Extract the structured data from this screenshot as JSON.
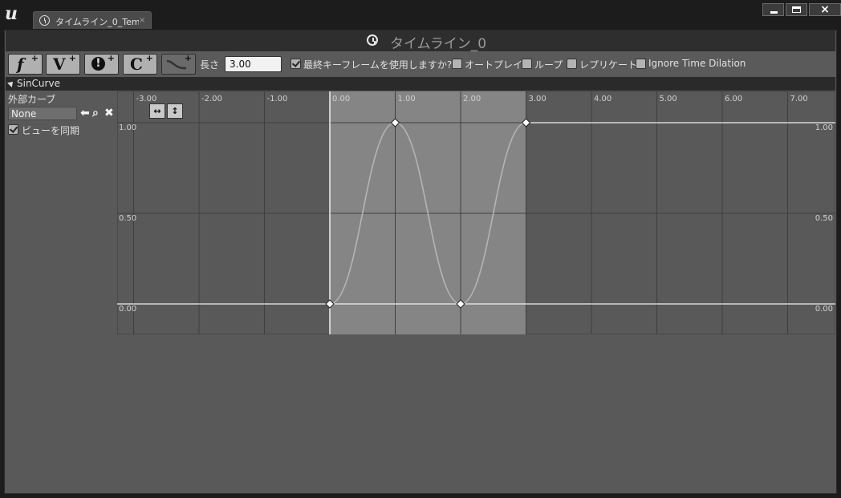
{
  "window": {
    "tab_title": "タイムライン_0_Tem",
    "tab_close": "×",
    "controls": {
      "minimize": "minimize",
      "maximize": "maximize",
      "close": "×"
    }
  },
  "header": {
    "title": "タイムライン_0"
  },
  "toolbar": {
    "buttons": [
      {
        "glyph": "f",
        "plus": "+"
      },
      {
        "glyph": "V",
        "plus": "+"
      },
      {
        "glyph": "!",
        "plus": "+"
      },
      {
        "glyph": "C",
        "plus": "+"
      },
      {
        "glyph": "~",
        "plus": "+"
      }
    ],
    "length_label": "長さ",
    "length_value": "3.00",
    "use_last_keyframe": {
      "label": "最終キーフレームを使用しますか?",
      "checked": true
    },
    "autoplay": {
      "label": "オートプレイ",
      "checked": false
    },
    "loop": {
      "label": "ループ",
      "checked": false
    },
    "replicated": {
      "label": "レプリケート",
      "checked": false
    },
    "ignore_time_dilation": {
      "label": "Ignore Time Dilation",
      "checked": false
    }
  },
  "track": {
    "name": "SinCurve",
    "external_curve_label": "外部カーブ",
    "external_curve_value": "None",
    "sync_view": {
      "label": "ビューを同期",
      "checked": true
    }
  },
  "curve_editor": {
    "x_ticks": [
      "-3.00",
      "-2.00",
      "-1.00",
      "0.00",
      "1.00",
      "2.00",
      "3.00",
      "4.00",
      "5.00",
      "6.00",
      "7.00"
    ],
    "y_ticks_left": [
      "1.00",
      "0.50",
      "0.00"
    ],
    "y_ticks_right": [
      "1.00",
      "0.50",
      "0.00"
    ],
    "fit_horizontal_icon": "fit-horizontal-icon",
    "fit_vertical_icon": "fit-vertical-icon"
  },
  "chart_data": {
    "type": "line",
    "xlim": [
      -3.0,
      7.6
    ],
    "ylim": [
      -0.08,
      1.2
    ],
    "active_range": [
      0.0,
      3.0
    ],
    "keys": [
      {
        "x": 0.0,
        "y": 0.0
      },
      {
        "x": 1.0,
        "y": 1.0
      },
      {
        "x": 2.0,
        "y": 0.0
      },
      {
        "x": 3.0,
        "y": 1.0
      }
    ],
    "grid": true
  },
  "colors": {
    "active_region": "#858585",
    "inactive_region": "#595959",
    "curve": "#b5b5b5",
    "line_white": "#f0f0f0"
  }
}
